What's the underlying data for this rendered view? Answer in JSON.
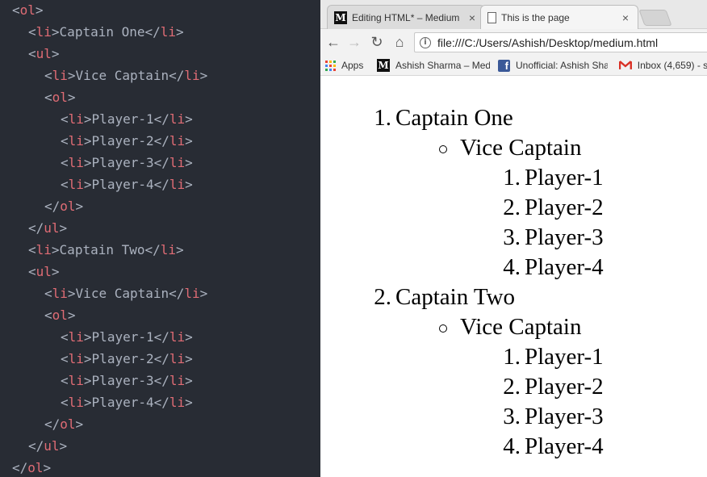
{
  "editor": {
    "lines": [
      {
        "open": "<",
        "tag": "ol",
        "close": ">",
        "text": "",
        "end": ""
      },
      {
        "open": "<",
        "tag": "li",
        "close": ">",
        "text": "Captain One",
        "end": "li"
      },
      {
        "open": "<",
        "tag": "ul",
        "close": ">",
        "text": "",
        "end": ""
      },
      {
        "open": "<",
        "tag": "li",
        "close": ">",
        "text": "Vice Captain",
        "end": "li"
      },
      {
        "open": "<",
        "tag": "ol",
        "close": ">",
        "text": "",
        "end": ""
      },
      {
        "open": "<",
        "tag": "li",
        "close": ">",
        "text": "Player-1",
        "end": "li"
      },
      {
        "open": "<",
        "tag": "li",
        "close": ">",
        "text": "Player-2",
        "end": "li"
      },
      {
        "open": "<",
        "tag": "li",
        "close": ">",
        "text": "Player-3",
        "end": "li"
      },
      {
        "open": "<",
        "tag": "li",
        "close": ">",
        "text": "Player-4",
        "end": "li"
      },
      {
        "open": "</",
        "tag": "ol",
        "close": ">",
        "text": "",
        "end": ""
      },
      {
        "open": "</",
        "tag": "ul",
        "close": ">",
        "text": "",
        "end": ""
      },
      {
        "open": "<",
        "tag": "li",
        "close": ">",
        "text": "Captain Two",
        "end": "li"
      },
      {
        "open": "<",
        "tag": "ul",
        "close": ">",
        "text": "",
        "end": ""
      },
      {
        "open": "<",
        "tag": "li",
        "close": ">",
        "text": "Vice Captain",
        "end": "li"
      },
      {
        "open": "<",
        "tag": "ol",
        "close": ">",
        "text": "",
        "end": ""
      },
      {
        "open": "<",
        "tag": "li",
        "close": ">",
        "text": "Player-1",
        "end": "li"
      },
      {
        "open": "<",
        "tag": "li",
        "close": ">",
        "text": "Player-2",
        "end": "li"
      },
      {
        "open": "<",
        "tag": "li",
        "close": ">",
        "text": "Player-3",
        "end": "li"
      },
      {
        "open": "<",
        "tag": "li",
        "close": ">",
        "text": "Player-4",
        "end": "li"
      },
      {
        "open": "</",
        "tag": "ol",
        "close": ">",
        "text": "",
        "end": ""
      },
      {
        "open": "</",
        "tag": "ul",
        "close": ">",
        "text": "",
        "end": ""
      },
      {
        "open": "</",
        "tag": "ol",
        "close": ">",
        "text": "",
        "end": ""
      }
    ]
  },
  "browser": {
    "tabs": [
      {
        "title": "Editing HTML* – Medium",
        "favicon": "medium-icon",
        "close": "×"
      },
      {
        "title": "This is the page",
        "favicon": "page-icon",
        "close": "×"
      }
    ],
    "favicon_letter": "M",
    "nav": {
      "back": "←",
      "forward": "→",
      "reload": "↻",
      "home": "⌂"
    },
    "address": "file:///C:/Users/Ashish/Desktop/medium.html",
    "info_glyph": "i",
    "bookmarks": [
      {
        "label": "Apps",
        "icon": "apps-grid-icon"
      },
      {
        "label": "Ashish Sharma – Medium",
        "icon": "medium-icon"
      },
      {
        "label": "Unofficial: Ashish Sharma",
        "icon": "facebook-icon"
      },
      {
        "label": "Inbox (4,659) - s",
        "icon": "gmail-icon"
      }
    ],
    "facebook_letter": "f"
  },
  "page": {
    "captains": [
      {
        "number": "1.",
        "name": "Captain One",
        "vice": "Vice Captain",
        "players": [
          {
            "number": "1.",
            "name": "Player-1"
          },
          {
            "number": "2.",
            "name": "Player-2"
          },
          {
            "number": "3.",
            "name": "Player-3"
          },
          {
            "number": "4.",
            "name": "Player-4"
          }
        ]
      },
      {
        "number": "2.",
        "name": "Captain Two",
        "vice": "Vice Captain",
        "players": [
          {
            "number": "1.",
            "name": "Player-1"
          },
          {
            "number": "2.",
            "name": "Player-2"
          },
          {
            "number": "3.",
            "name": "Player-3"
          },
          {
            "number": "4.",
            "name": "Player-4"
          }
        ]
      }
    ]
  },
  "colors": {
    "editor_bg": "#282c34",
    "tag": "#e06c75",
    "punct": "#abb2bf",
    "apps_dots": [
      "#ea4335",
      "#fbbc05",
      "#34a853",
      "#4285f4",
      "#ea4335",
      "#fbbc05",
      "#34a853",
      "#4285f4",
      "#ea4335"
    ]
  }
}
